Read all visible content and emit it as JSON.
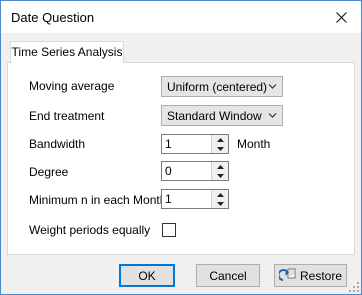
{
  "window": {
    "title": "Date Question"
  },
  "tabs": [
    {
      "label": "Time Series Analysis"
    }
  ],
  "fields": {
    "moving_average": {
      "label": "Moving average",
      "value": "Uniform (centered)"
    },
    "end_treatment": {
      "label": "End treatment",
      "value": "Standard Window"
    },
    "bandwidth": {
      "label": "Bandwidth",
      "value": "1",
      "unit": "Month"
    },
    "degree": {
      "label": "Degree",
      "value": "0"
    },
    "minimum_n": {
      "label": "Minimum n in each Month",
      "value": "1"
    },
    "weight_periods": {
      "label": "Weight periods equally",
      "checked": false
    }
  },
  "buttons": {
    "ok": "OK",
    "cancel": "Cancel",
    "restore": "Restore"
  },
  "icons": {
    "close": "close-icon",
    "dropdown": "chevron-down-icon",
    "spin_up": "spin-up-icon",
    "spin_down": "spin-down-icon",
    "restore": "restore-icon",
    "resize": "resize-gripper-icon"
  }
}
